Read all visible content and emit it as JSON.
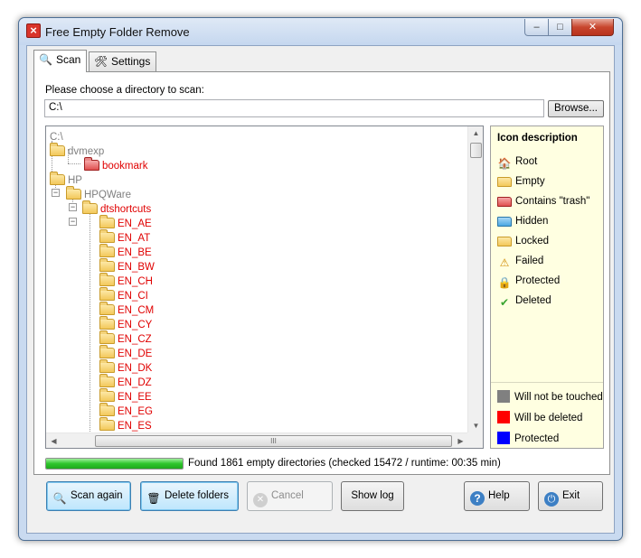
{
  "window": {
    "title": "Free Empty Folder Remove",
    "minimize": "–",
    "maximize": "□",
    "close": "✕"
  },
  "tabs": [
    {
      "label": "Scan",
      "icon": "magnifier-icon",
      "active": true
    },
    {
      "label": "Settings",
      "icon": "tools-icon",
      "active": false
    }
  ],
  "scan": {
    "prompt": "Please choose a directory to scan:",
    "path_value": "C:\\",
    "browse_label": "Browse..."
  },
  "tree": {
    "rows": [
      {
        "label": "C:\\",
        "color": "gray",
        "folder": "none"
      },
      {
        "label": "dvmexp",
        "color": "gray",
        "folder": "empty"
      },
      {
        "label": "bookmark",
        "color": "red",
        "folder": "trash"
      },
      {
        "label": "HP",
        "color": "gray",
        "folder": "empty"
      },
      {
        "label": "HPQWare",
        "color": "gray",
        "folder": "empty"
      },
      {
        "label": "dtshortcuts",
        "color": "red",
        "folder": "empty"
      },
      {
        "label": "EN_AE",
        "color": "red",
        "folder": "empty"
      },
      {
        "label": "EN_AT",
        "color": "red",
        "folder": "empty"
      },
      {
        "label": "EN_BE",
        "color": "red",
        "folder": "empty"
      },
      {
        "label": "EN_BW",
        "color": "red",
        "folder": "empty"
      },
      {
        "label": "EN_CH",
        "color": "red",
        "folder": "empty"
      },
      {
        "label": "EN_CI",
        "color": "red",
        "folder": "empty"
      },
      {
        "label": "EN_CM",
        "color": "red",
        "folder": "empty"
      },
      {
        "label": "EN_CY",
        "color": "red",
        "folder": "empty"
      },
      {
        "label": "EN_CZ",
        "color": "red",
        "folder": "empty"
      },
      {
        "label": "EN_DE",
        "color": "red",
        "folder": "empty"
      },
      {
        "label": "EN_DK",
        "color": "red",
        "folder": "empty"
      },
      {
        "label": "EN_DZ",
        "color": "red",
        "folder": "empty"
      },
      {
        "label": "EN_EE",
        "color": "red",
        "folder": "empty"
      },
      {
        "label": "EN_EG",
        "color": "red",
        "folder": "empty"
      },
      {
        "label": "EN_ES",
        "color": "red",
        "folder": "empty"
      }
    ],
    "hscroll_grip": "III"
  },
  "legend": {
    "title": "Icon description",
    "items": [
      {
        "label": "Root",
        "icon": "root-folder-icon"
      },
      {
        "label": "Empty",
        "icon": "empty-folder-icon"
      },
      {
        "label": "Contains \"trash\"",
        "icon": "trash-folder-icon"
      },
      {
        "label": "Hidden",
        "icon": "hidden-folder-icon"
      },
      {
        "label": "Locked",
        "icon": "locked-folder-icon"
      },
      {
        "label": "Failed",
        "icon": "warning-icon"
      },
      {
        "label": "Protected",
        "icon": "padlock-icon"
      },
      {
        "label": "Deleted",
        "icon": "checkmark-icon"
      }
    ],
    "colors": [
      {
        "label": "Will not be touched",
        "color": "#808080"
      },
      {
        "label": "Will be deleted",
        "color": "#ff0000"
      },
      {
        "label": "Protected",
        "color": "#0000ff"
      }
    ]
  },
  "progress": {
    "value_percent": 100
  },
  "status": "Found 1861 empty directories (checked 15472 / runtime: 00:35 min)",
  "buttons": {
    "scan_again": "Scan again",
    "delete_folders": "Delete folders",
    "cancel": "Cancel",
    "show_log": "Show log",
    "help": "Help",
    "exit": "Exit"
  }
}
